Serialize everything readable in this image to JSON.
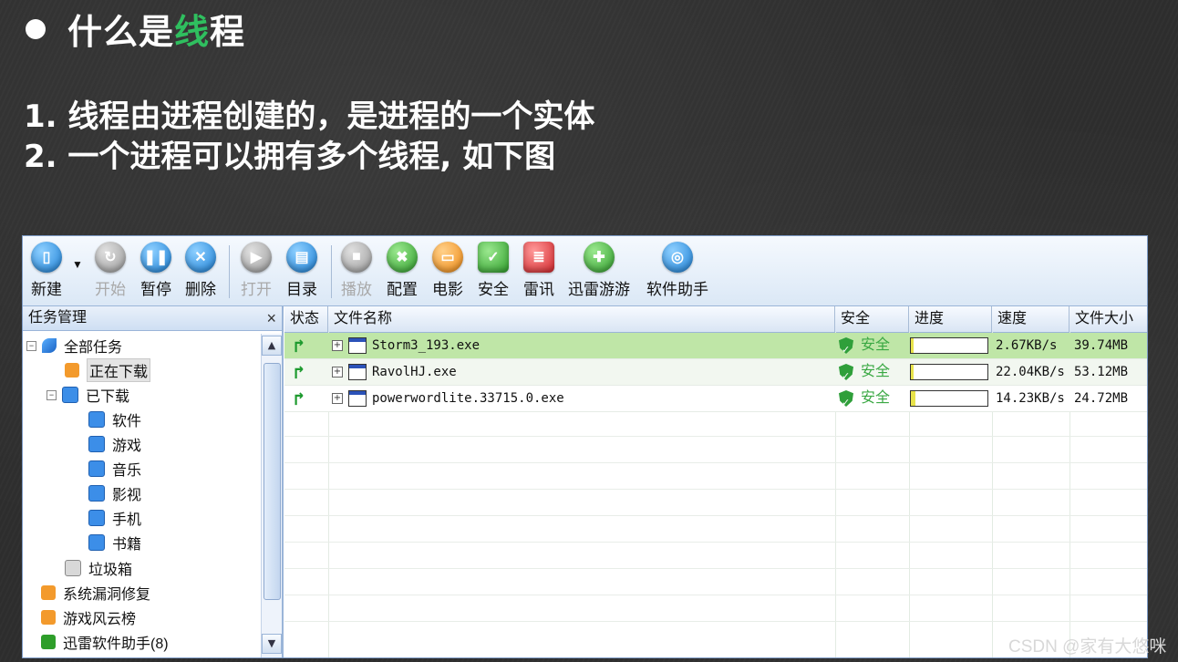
{
  "slide": {
    "title_prefix": "什么是",
    "title_highlight": "线",
    "title_suffix": "程",
    "line1": "1. 线程由进程创建的，是进程的一个实体",
    "line2": "2. 一个进程可以拥有多个线程, 如下图"
  },
  "toolbar": {
    "new": "新建",
    "start": "开始",
    "pause": "暂停",
    "delete": "删除",
    "open": "打开",
    "directory": "目录",
    "play": "播放",
    "config": "配置",
    "movie": "电影",
    "security": "安全",
    "news": "雷讯",
    "games": "迅雷游游",
    "helper": "软件助手"
  },
  "sidebar": {
    "title": "任务管理",
    "close": "×",
    "items": {
      "all": "全部任务",
      "downloading": "正在下载",
      "downloaded": "已下载",
      "software": "软件",
      "games": "游戏",
      "music": "音乐",
      "video": "影视",
      "mobile": "手机",
      "books": "书籍",
      "trash": "垃圾箱",
      "patch": "系统漏洞修复",
      "game_rank": "游戏风云榜",
      "soft_helper": "迅雷软件助手(8)"
    }
  },
  "table": {
    "headers": {
      "status": "状态",
      "filename": "文件名称",
      "safety": "安全",
      "progress": "进度",
      "speed": "速度",
      "size": "文件大小"
    },
    "rows": [
      {
        "name": "Storm3_193.exe",
        "safety": "安全",
        "progress": "0.4%",
        "progress_value": 0.004,
        "speed": "2.67KB/s",
        "size": "39.74MB"
      },
      {
        "name": "RavolHJ.exe",
        "safety": "安全",
        "progress": "2.4%",
        "progress_value": 0.024,
        "speed": "22.04KB/s",
        "size": "53.12MB"
      },
      {
        "name": "powerwordlite.33715.0.exe",
        "safety": "安全",
        "progress": "5.2%",
        "progress_value": 0.052,
        "speed": "14.23KB/s",
        "size": "24.72MB"
      }
    ]
  },
  "watermark": "CSDN @家有大悠咪",
  "colors": {
    "title_highlight": "#2fbf5f",
    "selected_row": "#bfe6a7",
    "safe_green": "#3aa843"
  }
}
